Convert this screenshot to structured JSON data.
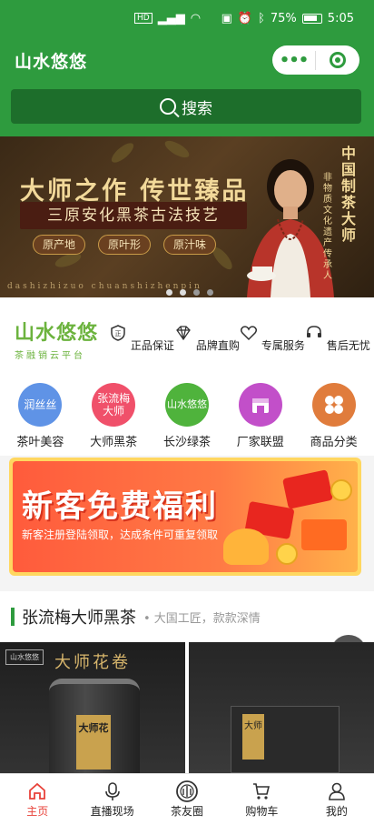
{
  "status_bar": {
    "battery": "75%",
    "time": "5:05"
  },
  "header": {
    "title": "山水悠悠",
    "menu_label": "•••"
  },
  "search": {
    "label": "搜索"
  },
  "banner": {
    "headline": "大师之作 传世臻品",
    "subline": "三原安化黑茶古法技艺",
    "tags": [
      "原产地",
      "原叶形",
      "原汁味"
    ],
    "pinyin": "dashizhizuo chuanshizhenpin",
    "vertical_title": "中国制茶大师",
    "vertical_sub": "非物质文化遗产传承人"
  },
  "brand": {
    "name": "山水悠悠",
    "subtitle": "茶融销云平台"
  },
  "features": [
    {
      "label": "正品保证"
    },
    {
      "label": "品牌直购"
    },
    {
      "label": "专属服务"
    },
    {
      "label": "售后无忧"
    }
  ],
  "categories": [
    {
      "label": "茶叶美容",
      "icon_text": "润丝丝",
      "color": "#3f7fe0"
    },
    {
      "label": "大师黑茶",
      "icon_text": "张流梅大师",
      "color": "#f0506a"
    },
    {
      "label": "长沙绿茶",
      "icon_text": "山水悠悠",
      "color": "#4fb33c"
    },
    {
      "label": "厂家联盟",
      "icon_text": "",
      "color": "#c24fc9"
    },
    {
      "label": "商品分类",
      "icon_text": "",
      "color": "#e07c3c"
    }
  ],
  "promo": {
    "title": "新客免费福利",
    "subtitle": "新客注册登陆领取，达成条件可重复领取"
  },
  "section": {
    "title": "张流梅大师黑茶",
    "desc": "• 大国工匠，款款深情"
  },
  "products": [
    {
      "title": "大师花卷",
      "logo": "山水悠悠",
      "label": "大师花"
    },
    {
      "title": "",
      "logo": "",
      "label": "大师"
    }
  ],
  "tabs": [
    {
      "label": "主页",
      "icon": "home-icon",
      "active": true
    },
    {
      "label": "直播现场",
      "icon": "microphone-icon",
      "active": false
    },
    {
      "label": "茶友圈",
      "icon": "tea-circle-icon",
      "active": false
    },
    {
      "label": "购物车",
      "icon": "cart-icon",
      "active": false
    },
    {
      "label": "我的",
      "icon": "person-icon",
      "active": false
    }
  ],
  "colors": {
    "brand_green": "#2e9b3e",
    "active_tab": "#e8423a"
  }
}
